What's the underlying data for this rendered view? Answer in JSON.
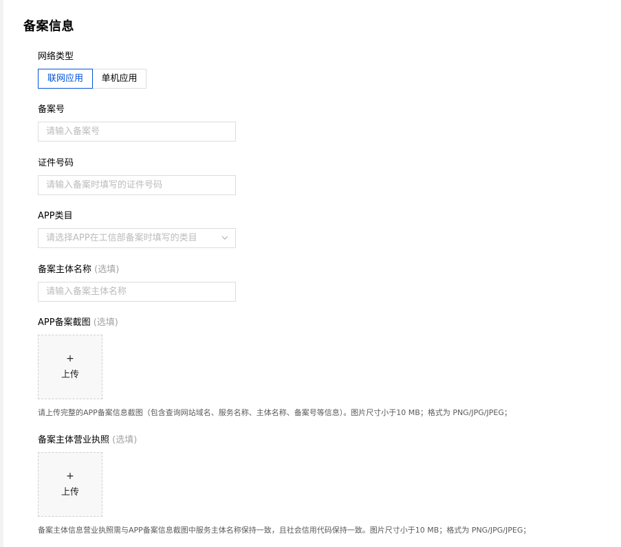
{
  "page": {
    "title": "备案信息"
  },
  "network_type": {
    "label": "网络类型",
    "options": [
      "联网应用",
      "单机应用"
    ],
    "selected": "联网应用"
  },
  "record_number": {
    "label": "备案号",
    "placeholder": "请输入备案号"
  },
  "certificate_number": {
    "label": "证件号码",
    "placeholder": "请输入备案时填写的证件号码"
  },
  "app_category": {
    "label": "APP类目",
    "placeholder": "请选择APP在工信部备案时填写的类目"
  },
  "subject_name": {
    "label": "备案主体名称",
    "optional": "(选填)",
    "placeholder": "请输入备案主体名称"
  },
  "app_screenshot": {
    "label": "APP备案截图",
    "optional": "(选填)",
    "upload_plus": "+",
    "upload_label": "上传",
    "hint": "请上传完整的APP备案信息截图（包含查询网站域名、服务名称、主体名称、备案号等信息）。图片尺寸小于10 MB；格式为 PNG/JPG/JPEG；"
  },
  "business_license": {
    "label": "备案主体营业执照",
    "optional": "(选填)",
    "upload_plus": "+",
    "upload_label": "上传",
    "hint": "备案主体信息营业执照需与APP备案信息截图中服务主体名称保持一致，且社会信用代码保持一致。图片尺寸小于10 MB；格式为 PNG/JPG/JPEG；"
  },
  "colors": {
    "accent": "#0052d9",
    "border": "#dcdcdc",
    "placeholder": "#bbbbbb",
    "optional": "#a3a3a3",
    "hint": "#5a5a5a"
  }
}
